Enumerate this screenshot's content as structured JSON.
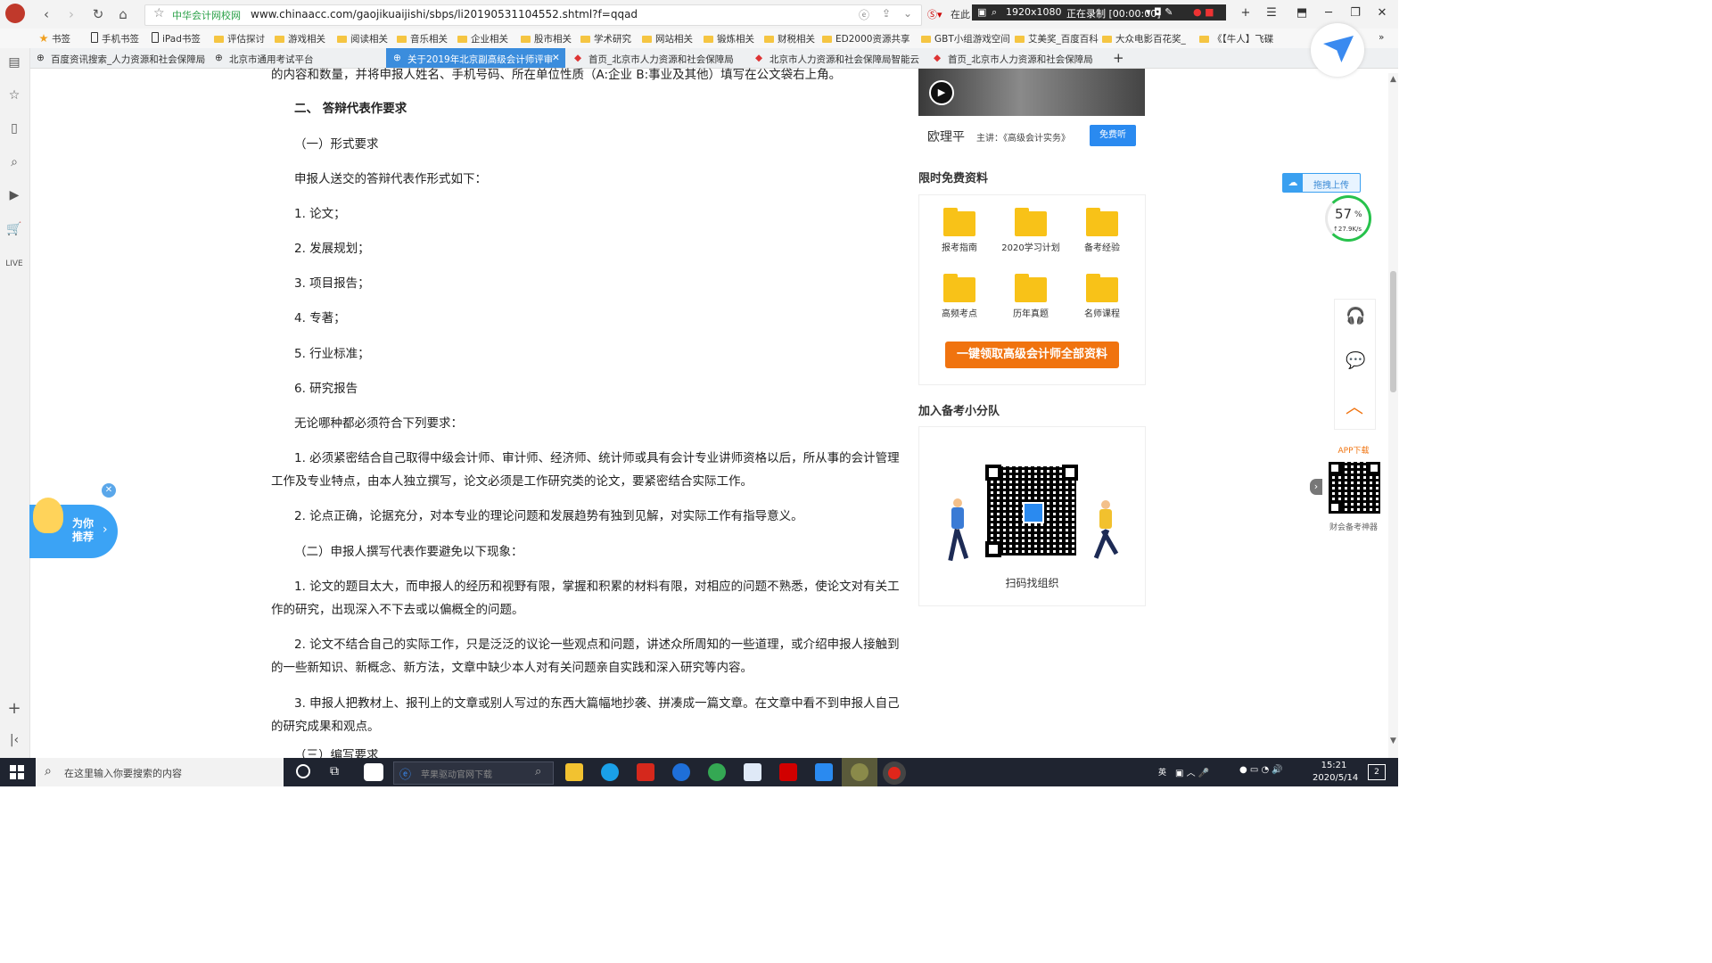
{
  "browser": {
    "site_name": "中华会计网校网",
    "url": "www.chinaacc.com/gaojikuaijishi/sbps/li20190531104552.shtml?f=qqad",
    "search_hint": "在此",
    "recorder": {
      "resolution": "1920x1080",
      "status": "正在录制 [00:00:00]"
    }
  },
  "bookmarks": [
    "书签",
    "手机书签",
    "iPad书签",
    "评估探讨",
    "游戏相关",
    "阅读相关",
    "音乐相关",
    "企业相关",
    "股市相关",
    "学术研究",
    "网站相关",
    "锻炼相关",
    "财税相关",
    "ED2000资源共享",
    "GBT小组游戏空间",
    "艾美奖_百度百科",
    "大众电影百花奖_",
    "《【牛人】飞碟"
  ],
  "tabs": [
    {
      "label": "百度资讯搜索_人力资源和社会保障局"
    },
    {
      "label": "北京市通用考试平台"
    },
    {
      "label": "关于2019年北京副高级会计师评审"
    },
    {
      "label": "首页_北京市人力资源和社会保障局"
    },
    {
      "label": "北京市人力资源和社会保障局智能云"
    },
    {
      "label": "首页_北京市人力资源和社会保障局"
    }
  ],
  "article": {
    "top_fragment": "的内容和数量，并将申报人姓名、手机号码、所在单位性质（A:企业 B:事业及其他）填写在公文袋右上角。",
    "heading2": "二、 答辩代表作要求",
    "sub1": "（一）形式要求",
    "intro": "申报人送交的答辩代表作形式如下：",
    "forms": [
      "1. 论文；",
      "2. 发展规划；",
      "3. 项目报告；",
      "4. 专著；",
      "5. 行业标准；",
      "6. 研究报告"
    ],
    "req_intro": "无论哪种都必须符合下列要求：",
    "req1_l1": "1. 必须紧密结合自己取得中级会计师、审计师、经济师、统计师或具有会计专业讲师资格以后，所从事的会计管理",
    "req1_l2": "工作及专业特点，由本人独立撰写，论文必须是工作研究类的论文，要紧密结合实际工作。",
    "req2": "2. 论点正确，论据充分，对本专业的理论问题和发展趋势有独到见解，对实际工作有指导意义。",
    "sub2": "（二）申报人撰写代表作要避免以下现象：",
    "avoid1_l1": "1. 论文的题目太大，而申报人的经历和视野有限，掌握和积累的材料有限，对相应的问题不熟悉，使论文对有关工",
    "avoid1_l2": "作的研究，出现深入不下去或以偏概全的问题。",
    "avoid2_l1": "2. 论文不结合自己的实际工作，只是泛泛的议论一些观点和问题，讲述众所周知的一些道理，或介绍申报人接触到",
    "avoid2_l2": "的一些新知识、新概念、新方法，文章中缺少本人对有关问题亲自实践和深入研究等内容。",
    "avoid3_l1": "3. 申报人把教材上、报刊上的文章或别人写过的东西大篇幅地抄袭、拼凑成一篇文章。在文章中看不到申报人自己",
    "avoid3_l2": "的研究成果和观点。",
    "sub3_partial": "（三）编写要求"
  },
  "sidebar": {
    "teacher_name": "欧理平",
    "teacher_course": "主讲：《高级会计实务》",
    "listen_btn": "免费听",
    "free_title": "限时免费资料",
    "folders": [
      "报考指南",
      "2020学习计划",
      "备考经验",
      "高频考点",
      "历年真题",
      "名师课程"
    ],
    "get_all_btn": "一键领取高级会计师全部资料",
    "group_title": "加入备考小分队",
    "scan_label": "扫码找组织"
  },
  "floating": {
    "recommend": "为你推荐",
    "upload": "拖拽上传",
    "speed_pct": "57",
    "speed_unit": "%",
    "speed_rate": "↑27.9K/s",
    "app_download": "APP下载",
    "app_caption": "财会备考神器"
  },
  "taskbar": {
    "search_placeholder": "在这里输入你要搜索的内容",
    "ie_search": "苹果驱动官网下载",
    "ime": "英",
    "time": "15:21",
    "date": "2020/5/14",
    "notify_count": "2"
  }
}
